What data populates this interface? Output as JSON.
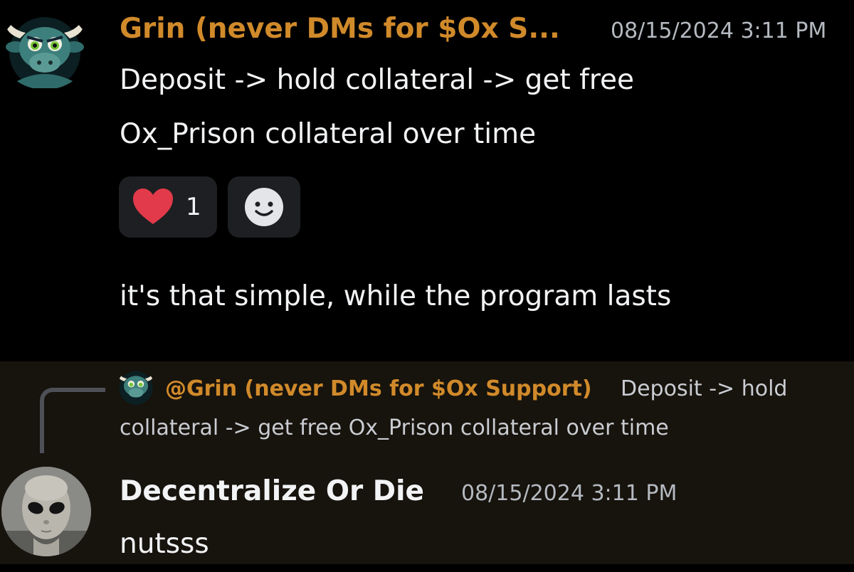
{
  "message1": {
    "username": "Grin (never DMs for $Ox S...",
    "timestamp": "08/15/2024 3:11 PM",
    "line1": "Deposit -> hold collateral -> get free",
    "line2": "Ox_Prison collateral over time",
    "reaction_count": "1",
    "followup": "it's that simple, while the program lasts"
  },
  "reply": {
    "mention": "@Grin (never DMs for $Ox Support)",
    "preview_line1": "Deposit -> hold",
    "preview_line2": "collateral -> get free Ox_Prison collateral over time"
  },
  "message2": {
    "username": "Decentralize Or Die",
    "timestamp": "08/15/2024 3:11 PM",
    "text": "nutsss"
  },
  "colors": {
    "username_accent": "#d18a2a",
    "heart": "#e23a4a",
    "reaction_bg": "#1e1f22"
  },
  "icons": {
    "heart": "heart-icon",
    "add_reaction": "add-reaction-icon",
    "bull_avatar": "bull-avatar-icon",
    "alien_avatar": "alien-avatar-icon"
  }
}
